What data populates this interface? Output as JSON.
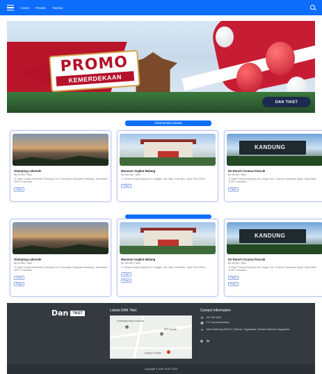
{
  "nav": {
    "links": [
      "Home",
      "Produk",
      "Tutorial"
    ]
  },
  "hero": {
    "promo_title": "PROMO",
    "promo_subtitle": "KEMERDEKAAN",
    "brand": "DAN TIKET"
  },
  "sections": [
    {
      "heading": "rekomendasi wisata",
      "cards": [
        {
          "photo": "glamping",
          "title": "Glamping Lakeside",
          "meta": "Rp 20.000 / Tiket",
          "desc": "Jl. Raya Ciwidey-Rancabali, Patengan, Kec. Rancabali, Kabupaten Bandung, Jawa Barat 40973, Indonesia",
          "button": "Detail"
        },
        {
          "photo": "museum",
          "title": "Museum Angkut Malang",
          "meta": "Rp 100.000 / Tiket",
          "desc": "Jl. Terusan Sultan Agung No.2, Ngaglik, Kec. Batu, Kota Batu, Jawa Timur 65314",
          "button": "Detail"
        },
        {
          "photo": "ranch",
          "title": "De Ranch Cisarua Puncak",
          "meta": "Rp 15.000 / Tiket",
          "desc": "Jl. Raya Puncak Gadog No.602, Bogor, Kec. Cisarua, Kabupaten Bogor, Jawa Barat 16750, Indonesia",
          "button": "Detail"
        }
      ]
    },
    {
      "heading": "",
      "cards": [
        {
          "photo": "glamping",
          "title": "Glamping Lakeside",
          "meta": "Rp 20.000 / Tiket",
          "desc": "Jl. Raya Ciwidey-Rancabali, Patengan, Kec. Rancabali, Kabupaten Bandung, Jawa Barat 40973, Indonesia",
          "button": "Detail",
          "button2": "Pesan"
        },
        {
          "photo": "museum",
          "title": "Museum Angkut Malang",
          "meta": "Rp 100.000 / Tiket",
          "desc": "Jl. Terusan Sultan Agung No.2, Ngaglik, Kec. Batu, Kota Batu, Jawa Timur 65314",
          "button": "Detail",
          "button2": "Pesan"
        },
        {
          "photo": "ranch",
          "title": "De Ranch Cisarua Puncak",
          "meta": "Rp 15.000 / Tiket",
          "desc": "Jl. Raya Puncak Gadog No.602, Bogor, Kec. Cisarua, Kabupaten Bogor, Jawa Barat 16750, Indonesia",
          "button": "Detail",
          "button2": "Pesan"
        }
      ]
    }
  ],
  "footer": {
    "brand": "Dan",
    "brand_badge": "TIKET",
    "map_title": "Lokasi DAN Tiket",
    "map_labels": [
      "Universitas Islam Indonesia",
      "BPR Syariah",
      "Kampus Terpadu"
    ],
    "contact_title": "Contact Information",
    "contacts": [
      {
        "icon": "phone-icon",
        "glyph": "✆",
        "text": "+62 000 0000"
      },
      {
        "icon": "grid-icon",
        "glyph": "▦",
        "text": "CV. Tiurma Hasibuan"
      },
      {
        "icon": "location-icon",
        "glyph": "⌖",
        "text": "Jalan Kaliurang KM14.5, Sleman, Yogyakarta, Daerah Istimewa Yogyakarta"
      }
    ],
    "socials": [
      "◎",
      "in"
    ]
  },
  "copyright": "Copyright © DAN TIKET 2023"
}
